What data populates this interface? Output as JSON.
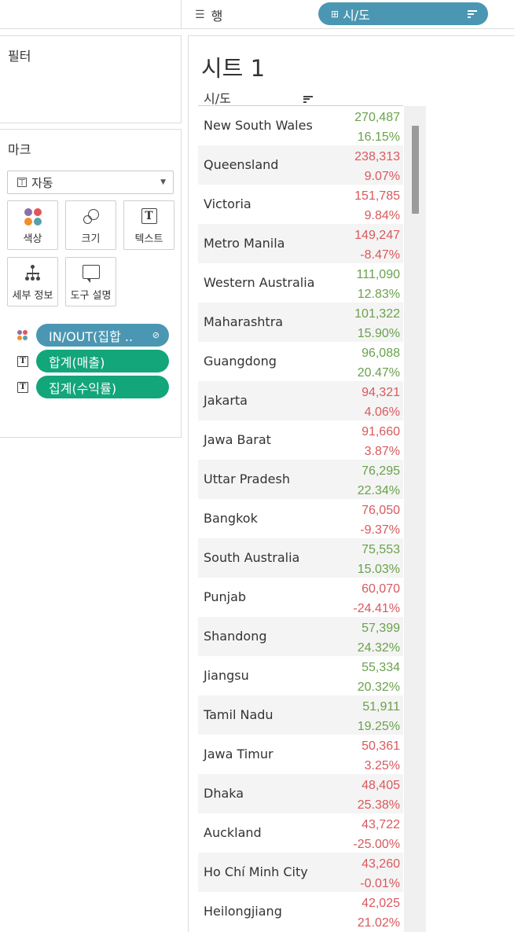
{
  "shelf": {
    "rows_label": "행",
    "rows_pill": "시/도"
  },
  "filters": {
    "title": "필터"
  },
  "marks": {
    "title": "마크",
    "type_select": "자동",
    "buttons": {
      "color": "색상",
      "size": "크기",
      "text": "텍스트",
      "detail": "세부 정보",
      "tooltip": "도구 설명"
    },
    "fields": [
      {
        "label": "IN/OUT(집합 ..",
        "type": "color"
      },
      {
        "label": "합계(매출)",
        "type": "text"
      },
      {
        "label": "집계(수익률)",
        "type": "text"
      }
    ]
  },
  "sheet": {
    "title": "시트 1",
    "column_header": "시/도",
    "rows": [
      {
        "name": "New South Wales",
        "sales": "270,487",
        "ratio": "16.15%",
        "status": "in"
      },
      {
        "name": "Queensland",
        "sales": "238,313",
        "ratio": "9.07%",
        "status": "out"
      },
      {
        "name": "Victoria",
        "sales": "151,785",
        "ratio": "9.84%",
        "status": "out"
      },
      {
        "name": "Metro Manila",
        "sales": "149,247",
        "ratio": "-8.47%",
        "status": "out"
      },
      {
        "name": "Western Australia",
        "sales": "111,090",
        "ratio": "12.83%",
        "status": "in"
      },
      {
        "name": "Maharashtra",
        "sales": "101,322",
        "ratio": "15.90%",
        "status": "in"
      },
      {
        "name": "Guangdong",
        "sales": "96,088",
        "ratio": "20.47%",
        "status": "in"
      },
      {
        "name": "Jakarta",
        "sales": "94,321",
        "ratio": "4.06%",
        "status": "out"
      },
      {
        "name": "Jawa Barat",
        "sales": "91,660",
        "ratio": "3.87%",
        "status": "out"
      },
      {
        "name": "Uttar Pradesh",
        "sales": "76,295",
        "ratio": "22.34%",
        "status": "in"
      },
      {
        "name": "Bangkok",
        "sales": "76,050",
        "ratio": "-9.37%",
        "status": "out"
      },
      {
        "name": "South Australia",
        "sales": "75,553",
        "ratio": "15.03%",
        "status": "in"
      },
      {
        "name": "Punjab",
        "sales": "60,070",
        "ratio": "-24.41%",
        "status": "out"
      },
      {
        "name": "Shandong",
        "sales": "57,399",
        "ratio": "24.32%",
        "status": "in"
      },
      {
        "name": "Jiangsu",
        "sales": "55,334",
        "ratio": "20.32%",
        "status": "in"
      },
      {
        "name": "Tamil Nadu",
        "sales": "51,911",
        "ratio": "19.25%",
        "status": "in"
      },
      {
        "name": "Jawa Timur",
        "sales": "50,361",
        "ratio": "3.25%",
        "status": "out"
      },
      {
        "name": "Dhaka",
        "sales": "48,405",
        "ratio": "25.38%",
        "status": "out"
      },
      {
        "name": "Auckland",
        "sales": "43,722",
        "ratio": "-25.00%",
        "status": "out"
      },
      {
        "name": "Ho Chí Minh City",
        "sales": "43,260",
        "ratio": "-0.01%",
        "status": "out"
      },
      {
        "name": "Heilongjiang",
        "sales": "42,025",
        "ratio": "21.02%",
        "status": "out"
      }
    ]
  },
  "colors": {
    "in": "#6aa14c",
    "out": "#d9595c",
    "dimension_pill": "#4b97b3",
    "measure_pill": "#12a67a"
  }
}
